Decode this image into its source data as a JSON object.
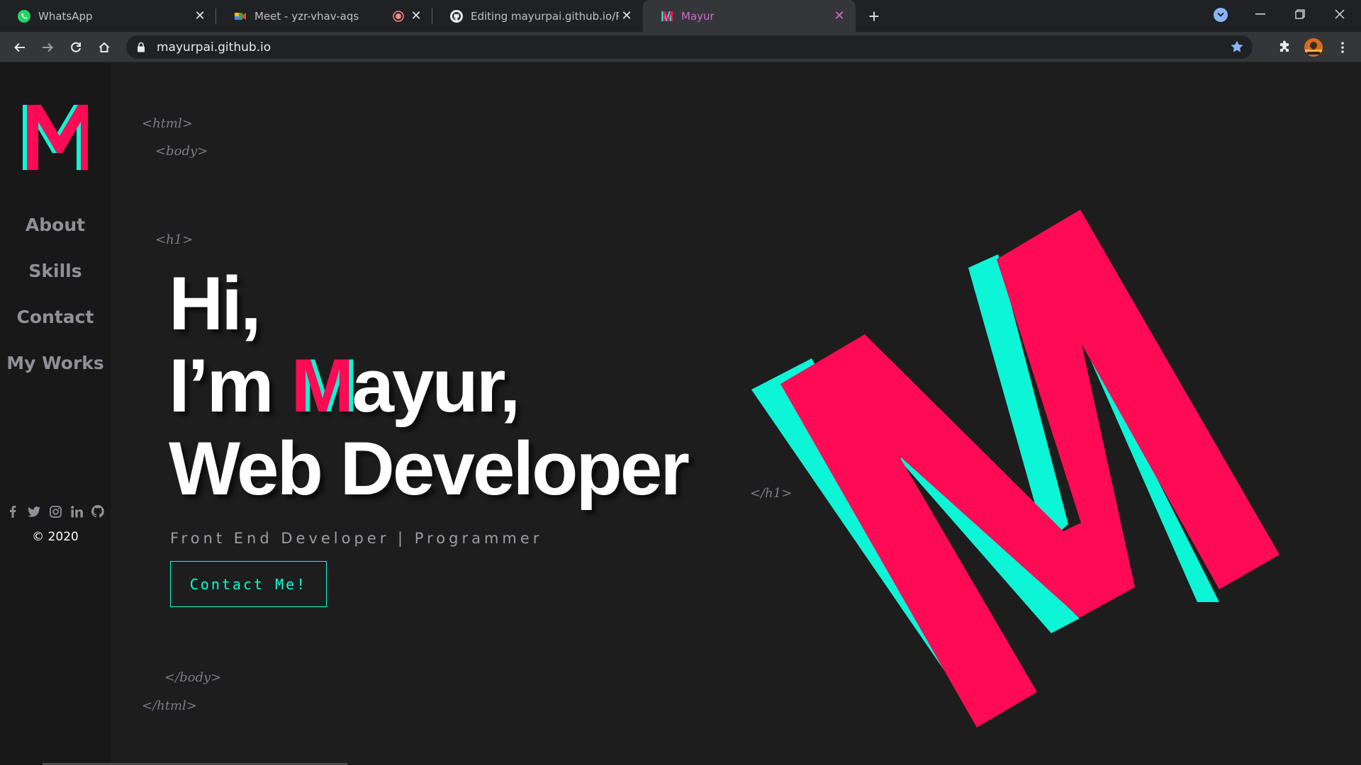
{
  "browser": {
    "tabs": [
      {
        "title": "WhatsApp",
        "icon": "whatsapp-icon"
      },
      {
        "title": "Meet - yzr-vhav-aqs",
        "icon": "google-meet-icon"
      },
      {
        "title": "Editing mayurpai.github.io/READ",
        "icon": "github-icon"
      },
      {
        "title": "Mayur",
        "icon": "mayur-m-icon",
        "active": true
      }
    ],
    "url": "mayurpai.github.io"
  },
  "sidebar": {
    "logo_letter": "M",
    "nav": [
      "About",
      "Skills",
      "Contact",
      "My Works"
    ],
    "socials": [
      "facebook-icon",
      "twitter-icon",
      "instagram-icon",
      "linkedin-icon",
      "github-icon"
    ],
    "copyright": "© 2020"
  },
  "tags": {
    "html_open": "<html>",
    "body_open": "<body>",
    "h1_open": "<h1>",
    "h1_close": "</h1>",
    "body_close": "</body>",
    "html_close": "</html>"
  },
  "hero": {
    "line1": "Hi,",
    "line2_prefix": "I’m ",
    "line2_m": "M",
    "line2_suffix": "ayur,",
    "line3": "Web Developer",
    "subtitle": "Front End Developer | Programmer",
    "cta": "Contact Me!"
  },
  "colors": {
    "accent_pink": "#ff0a54",
    "accent_cyan": "#08fdd8",
    "background": "#1d1d1d",
    "sidebar": "#181818"
  }
}
